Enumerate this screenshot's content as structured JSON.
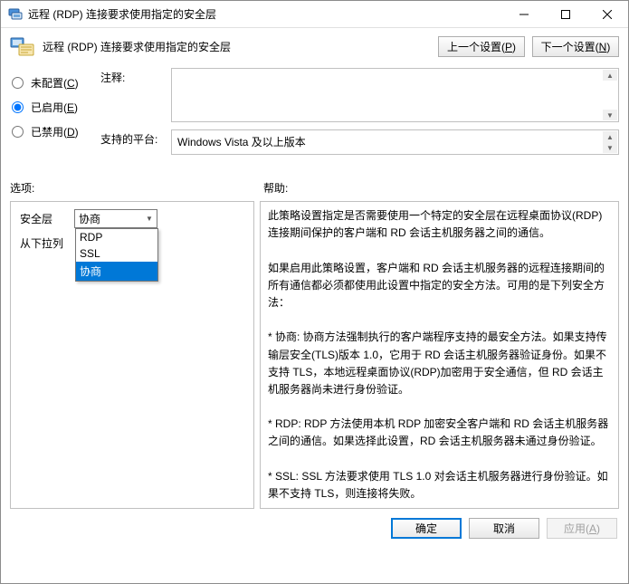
{
  "window": {
    "title": "远程 (RDP) 连接要求使用指定的安全层"
  },
  "header": {
    "title": "远程 (RDP) 连接要求使用指定的安全层",
    "prev": "上一个设置(P)",
    "next": "下一个设置(N)"
  },
  "radios": {
    "not_configured": "未配置(C)",
    "enabled": "已启用(E)",
    "disabled": "已禁用(D)",
    "selected": "enabled"
  },
  "fields": {
    "comment_label": "注释:",
    "comment_value": "",
    "platform_label": "支持的平台:",
    "platform_value": "Windows Vista 及以上版本"
  },
  "sections": {
    "options": "选项:",
    "help": "帮助:"
  },
  "options": {
    "security_layer_label": "安全层",
    "security_layer_value": "协商",
    "security_layer_items": [
      "RDP",
      "SSL",
      "协商"
    ],
    "security_layer_selected_index": 2,
    "from_dropdown_label": "从下拉列"
  },
  "help_text": "此策略设置指定是否需要使用一个特定的安全层在远程桌面协议(RDP)连接期间保护的客户端和 RD 会话主机服务器之间的通信。\n\n如果启用此策略设置，客户端和 RD 会话主机服务器的远程连接期间的所有通信都必须都使用此设置中指定的安全方法。可用的是下列安全方法：\n\n* 协商: 协商方法强制执行的客户端程序支持的最安全方法。如果支持传输层安全(TLS)版本 1.0，它用于 RD 会话主机服务器验证身份。如果不支持 TLS，本地远程桌面协议(RDP)加密用于安全通信，但 RD 会话主机服务器尚未进行身份验证。\n\n* RDP: RDP 方法使用本机 RDP 加密安全客户端和 RD 会话主机服务器之间的通信。如果选择此设置，RD 会话主机服务器未通过身份验证。\n\n* SSL: SSL 方法要求使用 TLS 1.0 对会话主机服务器进行身份验证。如果不支持 TLS，则连接将失败。\n\n如果你禁用或未配置此策略设置，在组策略级别未指定要用于远程连接到",
  "footer": {
    "ok": "确定",
    "cancel": "取消",
    "apply": "应用(A)"
  }
}
